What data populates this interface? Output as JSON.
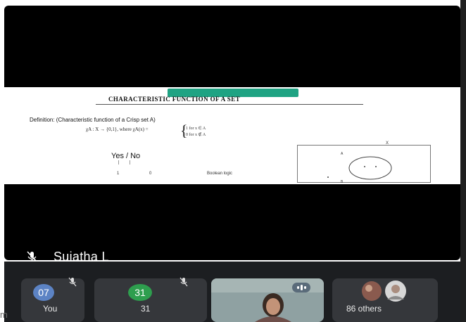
{
  "slide": {
    "title": "CHARACTERISTIC FUNCTION OF A SET",
    "definition": "Definition: (Characteristic function of a Crisp set A)",
    "formula": "χA : X → {0,1}, where χA(x) =",
    "brace": "{",
    "case_in": "1  for x ∈ A",
    "case_out": "0  for x ∉ A",
    "yes_no": "Yes / No",
    "one": "1",
    "zero": "0",
    "boolean_logic": "Boolean logic",
    "venn_x": "X",
    "venn_a": "A",
    "venn_b": "B"
  },
  "stage": {
    "presenter_name": "Sujatha L"
  },
  "participants": {
    "you": {
      "initials": "07",
      "label": "You",
      "avatar_color": "#5c83c4",
      "mic_icon": "mic-off-icon"
    },
    "p31": {
      "initials": "31",
      "label": "31",
      "avatar_color": "#2e9e4e",
      "mic_icon": "mic-off-icon"
    },
    "video": {
      "icon": "speaking-indicator-icon"
    },
    "others": {
      "label": "86 others"
    }
  },
  "edge": {
    "left_text": "m"
  },
  "colors": {
    "stage_background": "#000000",
    "tray_background": "#1c1e21",
    "presenting_chip": "#1fa383"
  }
}
